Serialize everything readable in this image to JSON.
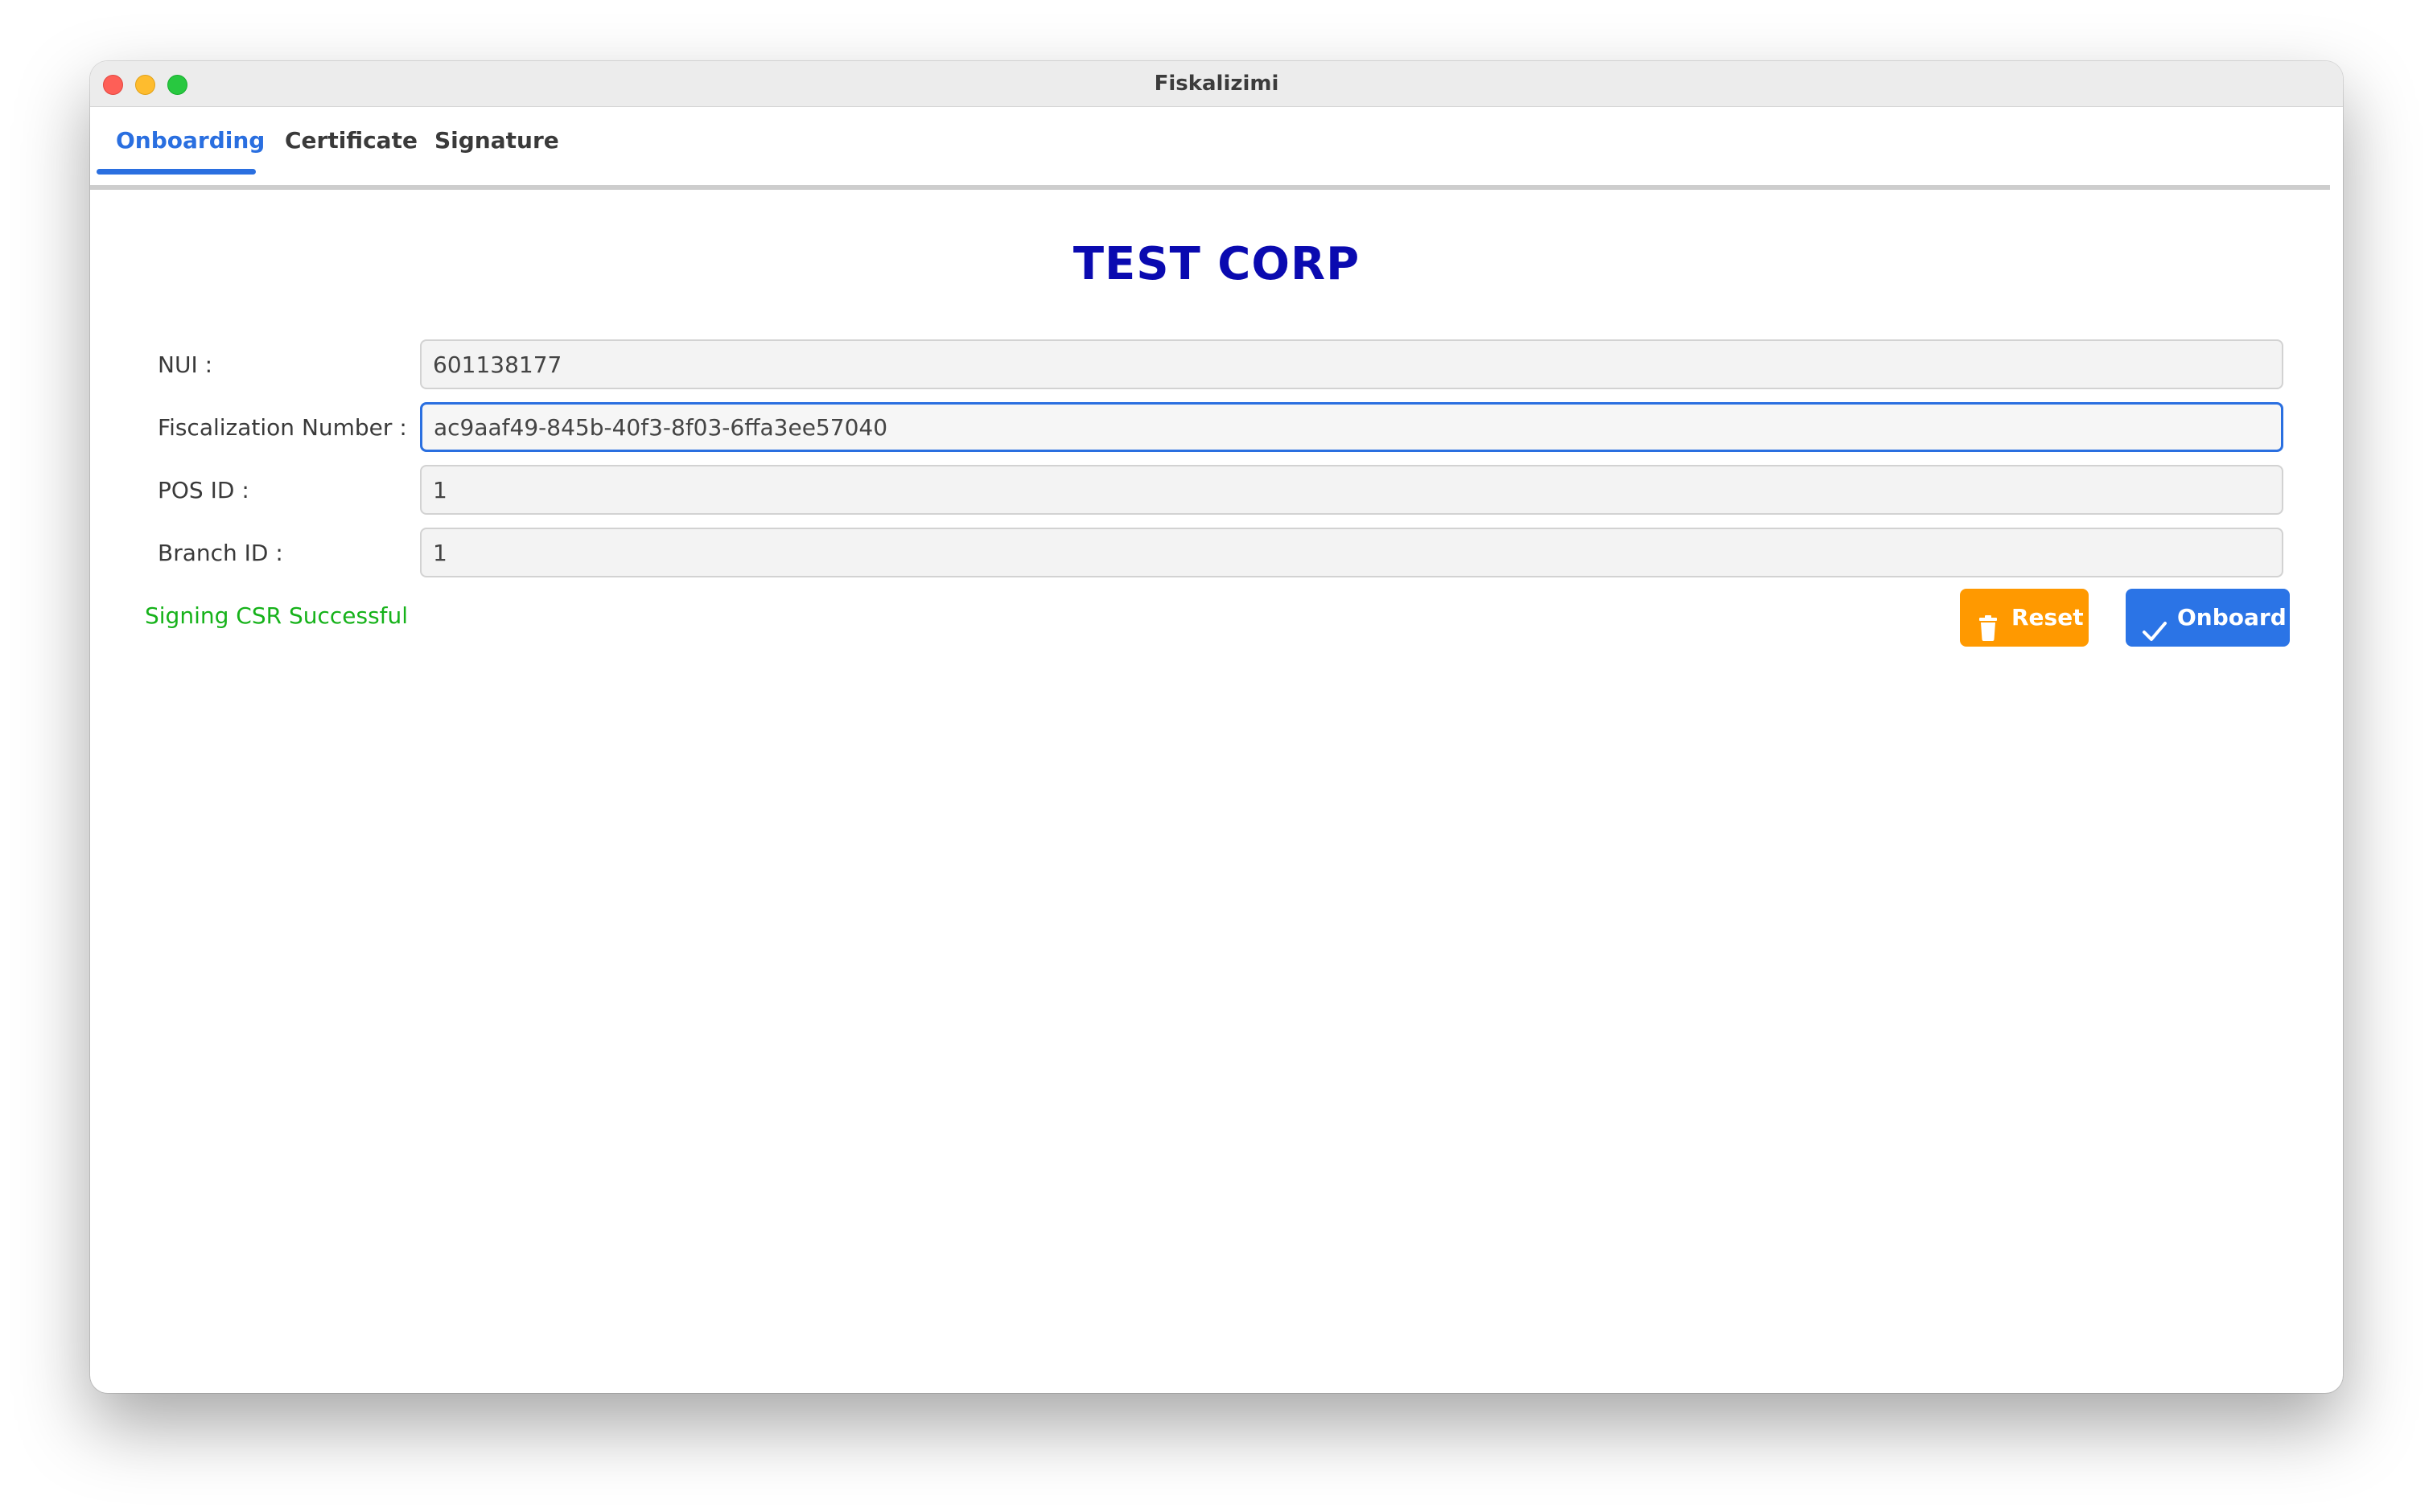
{
  "window": {
    "title": "Fiskalizimi"
  },
  "tabs": [
    {
      "label": "Onboarding",
      "active": true
    },
    {
      "label": "Certificate",
      "active": false
    },
    {
      "label": "Signature",
      "active": false
    }
  ],
  "form": {
    "company_name": "TEST CORP",
    "fields": [
      {
        "label": "NUI :",
        "value": "601138177"
      },
      {
        "label": "Fiscalization Number :",
        "value": "ac9aaf49-845b-40f3-8f03-6ffa3ee57040"
      },
      {
        "label": "POS ID :",
        "value": "1"
      },
      {
        "label": "Branch ID :",
        "value": "1"
      }
    ],
    "status_message": "Signing CSR Successful",
    "reset_label": "Reset",
    "onboard_label": "Onboard"
  },
  "colors": {
    "accent": "#2a6fe0",
    "company_title": "#0a0ab0",
    "status_success": "#16b21a",
    "reset_button": "#ff9900",
    "onboard_button": "#2b74e6"
  },
  "icons": {
    "reset": "trash-icon",
    "onboard": "checkmark-icon"
  }
}
